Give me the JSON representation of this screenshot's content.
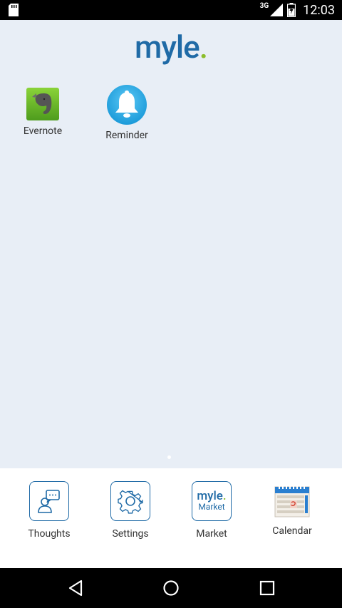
{
  "status_bar": {
    "network_label": "3G",
    "time": "12:03"
  },
  "header": {
    "logo_text": "myle",
    "logo_dot": "."
  },
  "home_apps": [
    {
      "label": "Evernote",
      "icon": "evernote-icon"
    },
    {
      "label": "Reminder",
      "icon": "bell-icon"
    }
  ],
  "dock": [
    {
      "label": "Thoughts",
      "icon": "thoughts-icon"
    },
    {
      "label": "Settings",
      "icon": "gear-icon"
    },
    {
      "label": "Market",
      "icon": "market-icon",
      "icon_text": "myle",
      "icon_dot": ".",
      "icon_subtext": "Market"
    },
    {
      "label": "Calendar",
      "icon": "calendar-icon"
    }
  ],
  "colors": {
    "brand_blue": "#1f6aa6",
    "brand_green": "#8bbd2b",
    "background": "#e8eef6"
  }
}
